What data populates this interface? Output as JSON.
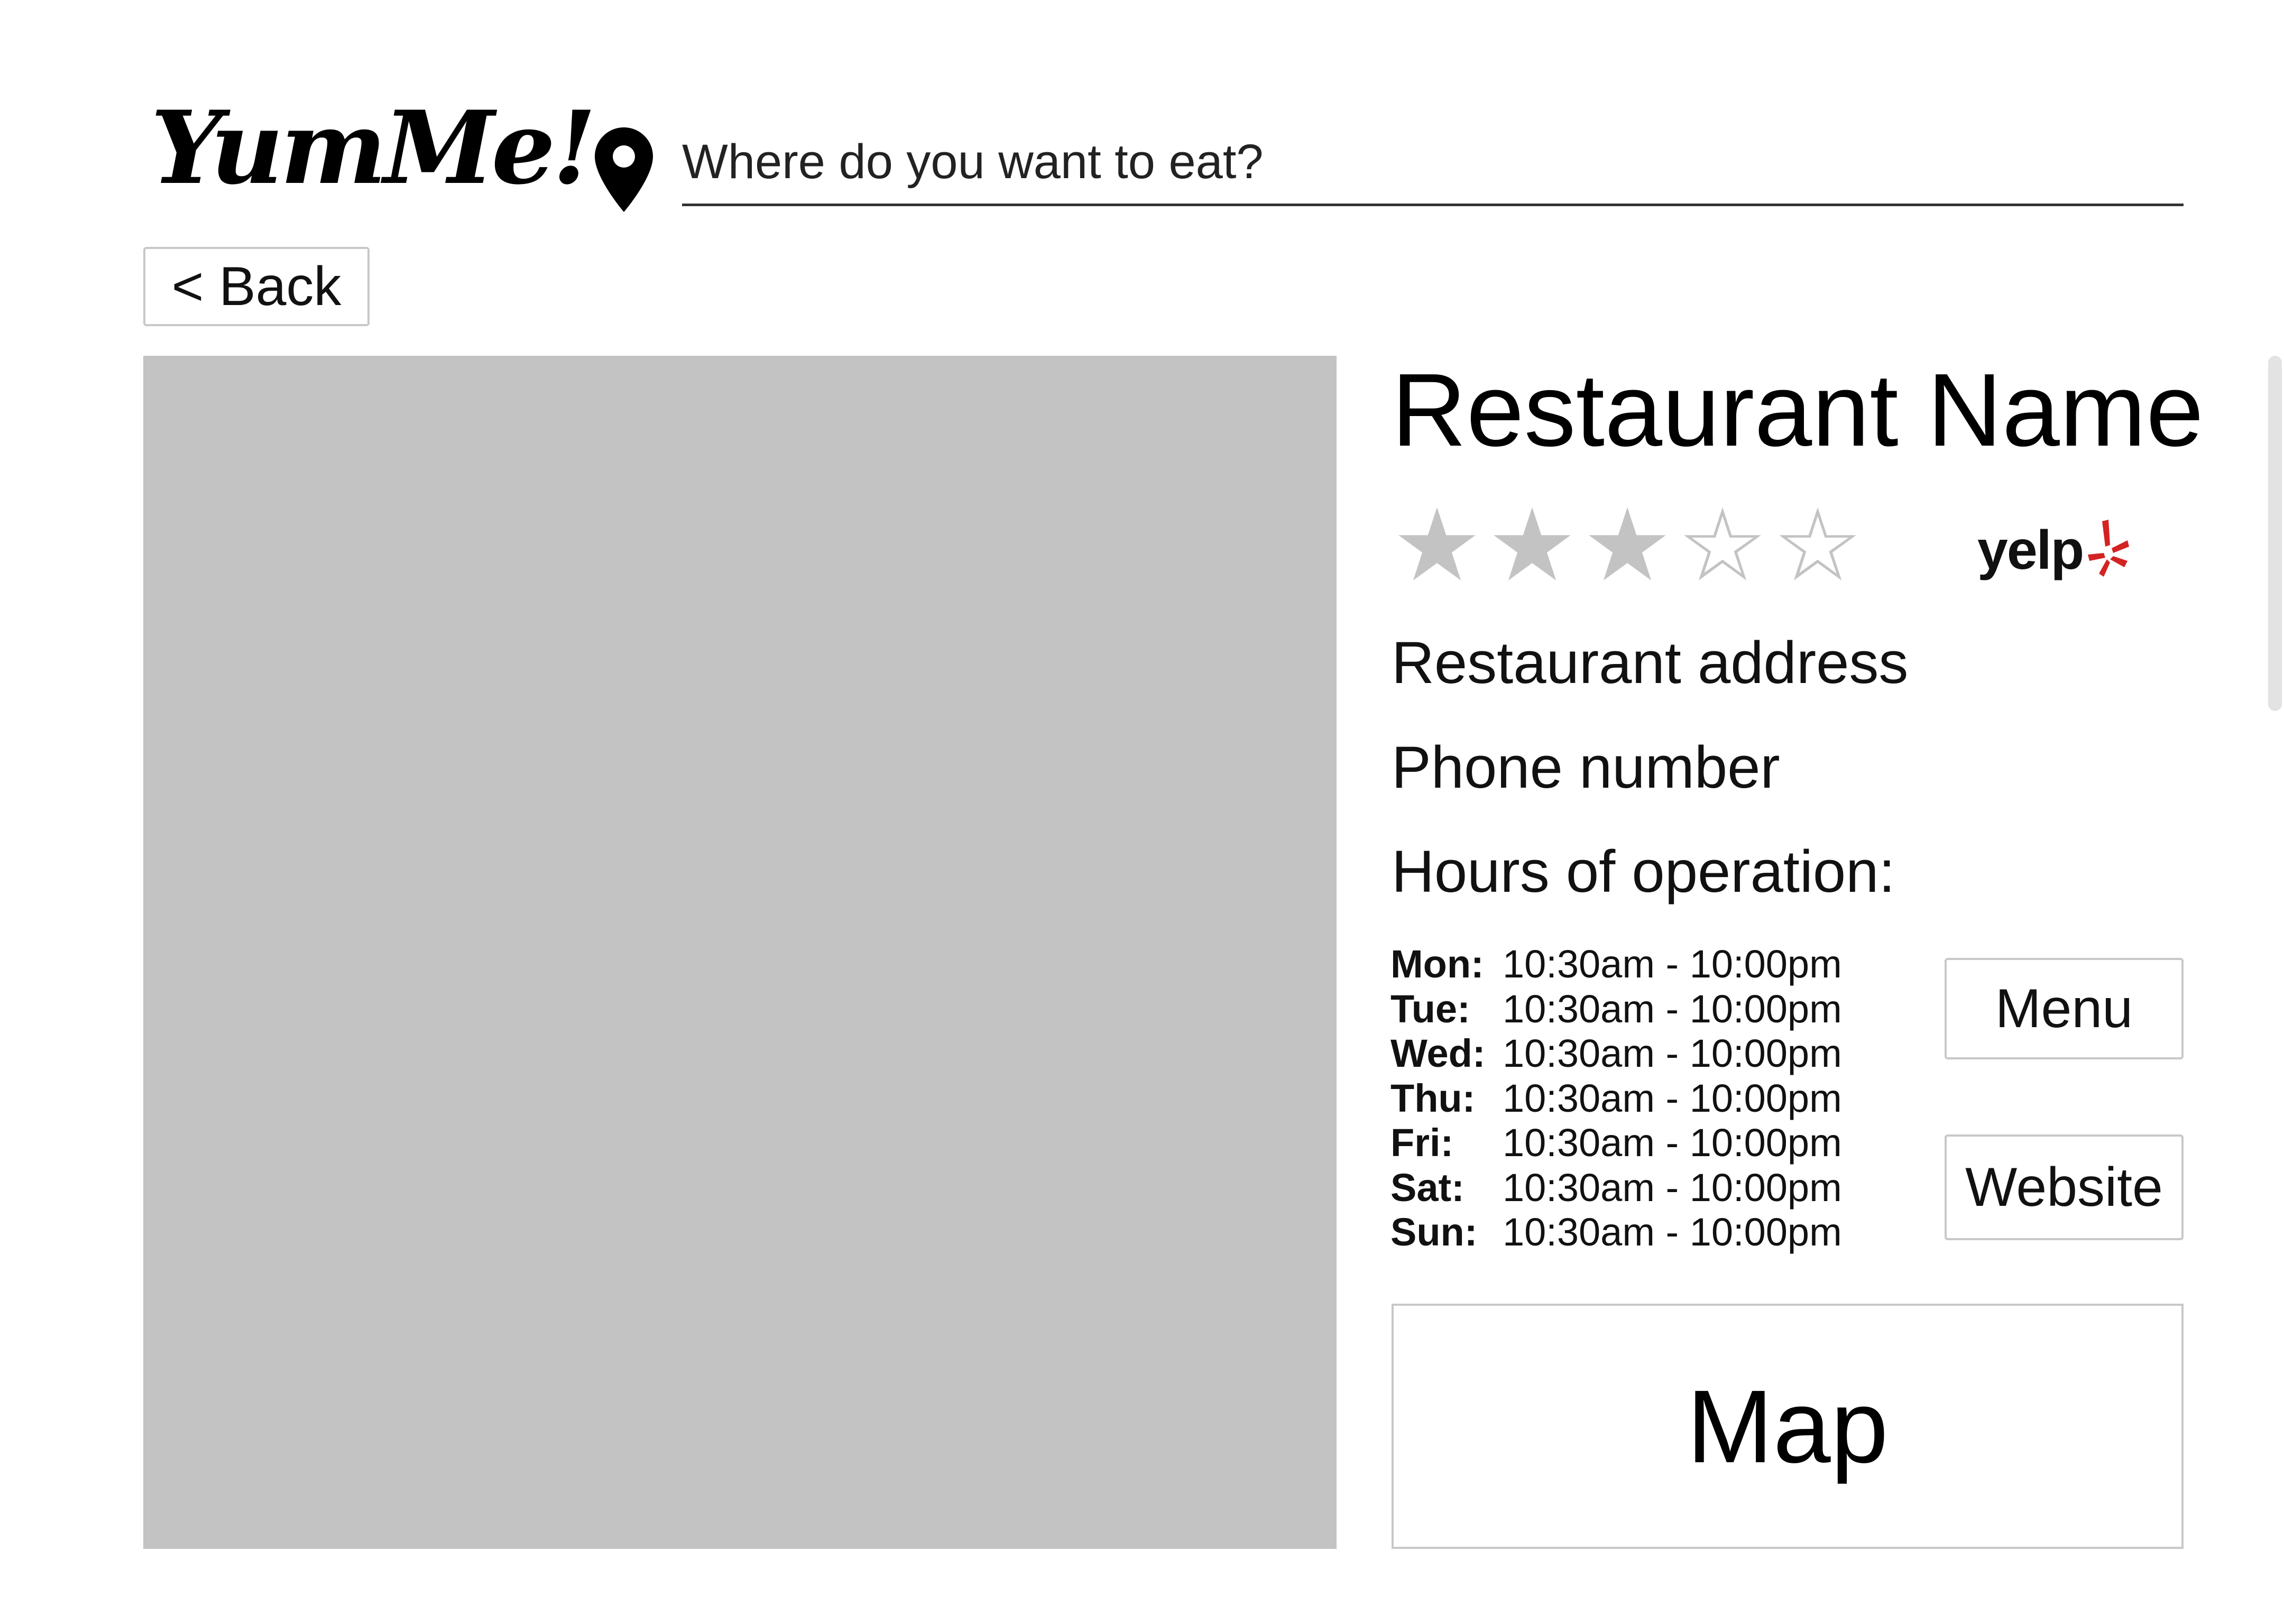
{
  "header": {
    "logo_text": "YumMe!",
    "search_placeholder": "Where do you want to eat?",
    "location_icon": "map-pin-icon"
  },
  "nav": {
    "back_label": "< Back"
  },
  "restaurant": {
    "name": "Restaurant Name",
    "rating": 3,
    "rating_max": 5,
    "rating_source": "yelp",
    "address": "Restaurant address",
    "phone": "Phone number",
    "hours_title": "Hours of operation:",
    "hours": [
      {
        "day": "Mon:",
        "time": "10:30am - 10:00pm"
      },
      {
        "day": "Tue:",
        "time": "10:30am - 10:00pm"
      },
      {
        "day": "Wed:",
        "time": "10:30am - 10:00pm"
      },
      {
        "day": "Thu:",
        "time": "10:30am - 10:00pm"
      },
      {
        "day": "Fri:",
        "time": "10:30am - 10:00pm"
      },
      {
        "day": "Sat:",
        "time": "10:30am - 10:00pm"
      },
      {
        "day": "Sun:",
        "time": "10:30am - 10:00pm"
      }
    ]
  },
  "actions": {
    "menu_label": "Menu",
    "website_label": "Website"
  },
  "map": {
    "label": "Map"
  },
  "colors": {
    "placeholder_gray": "#c3c3c3",
    "star_gray": "#c3c3c3",
    "yelp_red": "#d32323",
    "border_gray": "#c8c8c8"
  }
}
